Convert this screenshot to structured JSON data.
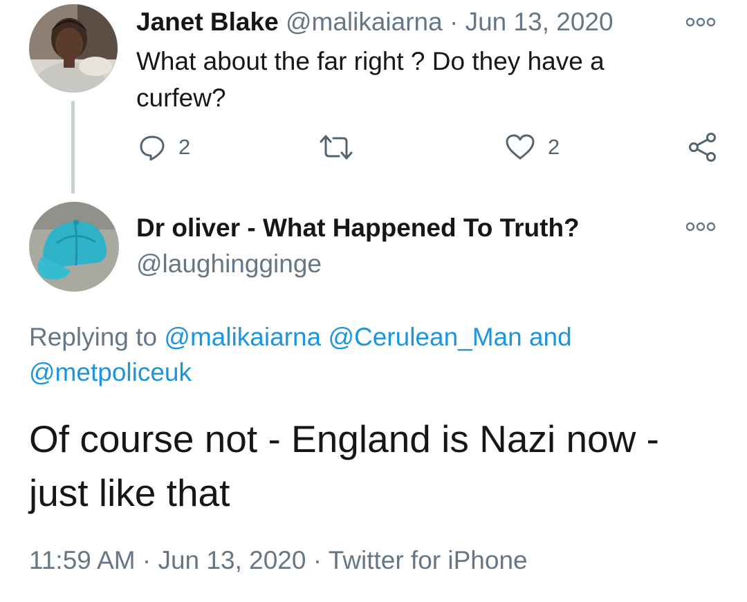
{
  "parent_tweet": {
    "author_name": "Janet Blake",
    "handle": "@malikaiarna",
    "separator": "·",
    "date": "Jun 13, 2020",
    "text": "What about the far right ? Do they have a curfew?",
    "actions": {
      "reply_count": "2",
      "retweet_count": "",
      "like_count": "2"
    },
    "icons": [
      "reply-icon",
      "retweet-icon",
      "like-icon",
      "share-icon",
      "more-options-icon"
    ]
  },
  "main_tweet": {
    "author_name": "Dr oliver - What Happened To Truth?",
    "handle": "@laughingginge",
    "replying_prefix": "Replying to",
    "replying_handles": [
      "@malikaiarna",
      "@Cerulean_Man",
      "@metpoliceuk"
    ],
    "replying_joiner": "and",
    "text": "Of course not - England is Nazi now - just like that",
    "time": "11:59 AM",
    "separator": "·",
    "date": "Jun 13, 2020",
    "source": "Twitter for iPhone"
  },
  "colors": {
    "text": "#14171a",
    "muted": "#657786",
    "link": "#1b95e0",
    "thread_line": "#c4cfd6"
  }
}
